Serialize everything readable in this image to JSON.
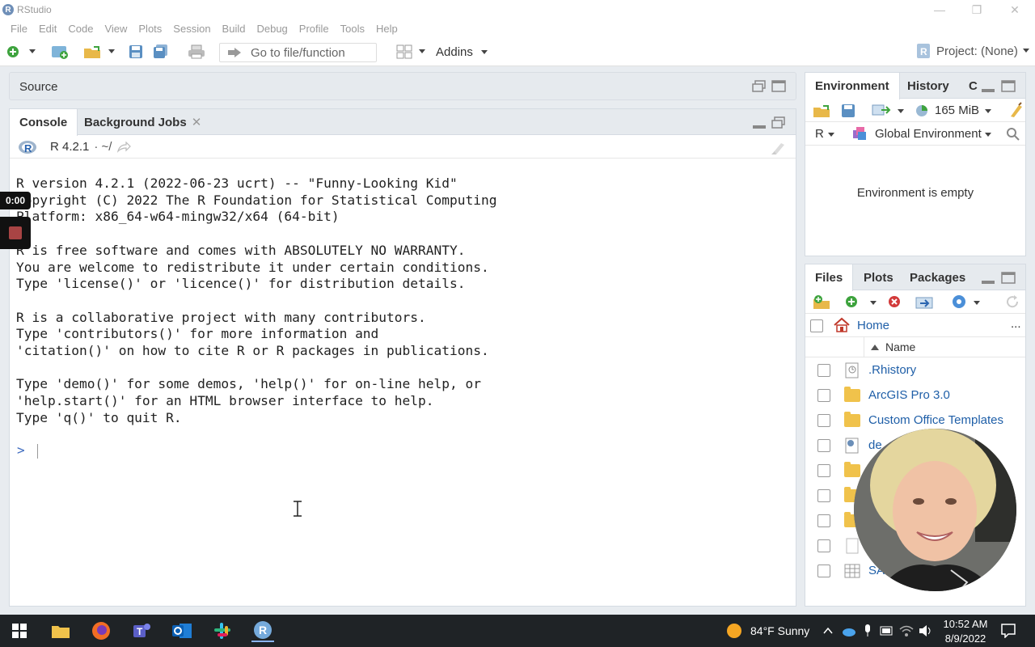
{
  "window": {
    "title": "RStudio"
  },
  "menu": [
    "File",
    "Edit",
    "Code",
    "View",
    "Plots",
    "Session",
    "Build",
    "Debug",
    "Profile",
    "Tools",
    "Help"
  ],
  "toolbar": {
    "goto_placeholder": "Go to file/function",
    "addins_label": "Addins",
    "project_label": "Project: (None)"
  },
  "source": {
    "label": "Source"
  },
  "console": {
    "tabs": [
      "Console",
      "Background Jobs"
    ],
    "r_version_label": "R 4.2.1",
    "path": "· ~/",
    "output": "R version 4.2.1 (2022-06-23 ucrt) -- \"Funny-Looking Kid\"\nCopyright (C) 2022 The R Foundation for Statistical Computing\nPlatform: x86_64-w64-mingw32/x64 (64-bit)\n\nR is free software and comes with ABSOLUTELY NO WARRANTY.\nYou are welcome to redistribute it under certain conditions.\nType 'license()' or 'licence()' for distribution details.\n\nR is a collaborative project with many contributors.\nType 'contributors()' for more information and\n'citation()' on how to cite R or R packages in publications.\n\nType 'demo()' for some demos, 'help()' for on-line help, or\n'help.start()' for an HTML browser interface to help.\nType 'q()' to quit R.",
    "prompt": ">"
  },
  "environment": {
    "tabs": [
      "Environment",
      "History",
      "C"
    ],
    "memory": "165 MiB",
    "lang": "R",
    "scope": "Global Environment",
    "empty_message": "Environment is empty"
  },
  "files": {
    "tabs": [
      "Files",
      "Plots",
      "Packages"
    ],
    "breadcrumb": "Home",
    "more": "...",
    "column_name": "Name",
    "items": [
      {
        "name": ".Rhistory",
        "type": "history"
      },
      {
        "name": "ArcGIS Pro 3.0",
        "type": "folder"
      },
      {
        "name": "Custom Office Templates",
        "type": "folder"
      },
      {
        "name": "de",
        "type": "file-settings"
      },
      {
        "name": "",
        "type": "folder"
      },
      {
        "name": "",
        "type": "folder"
      },
      {
        "name": "",
        "type": "folder"
      },
      {
        "name": "",
        "type": "file"
      },
      {
        "name": "SA",
        "type": "table"
      }
    ]
  },
  "recording": {
    "time": "0:00"
  },
  "taskbar": {
    "weather": "84°F  Sunny",
    "time": "10:52 AM",
    "date": "8/9/2022"
  }
}
